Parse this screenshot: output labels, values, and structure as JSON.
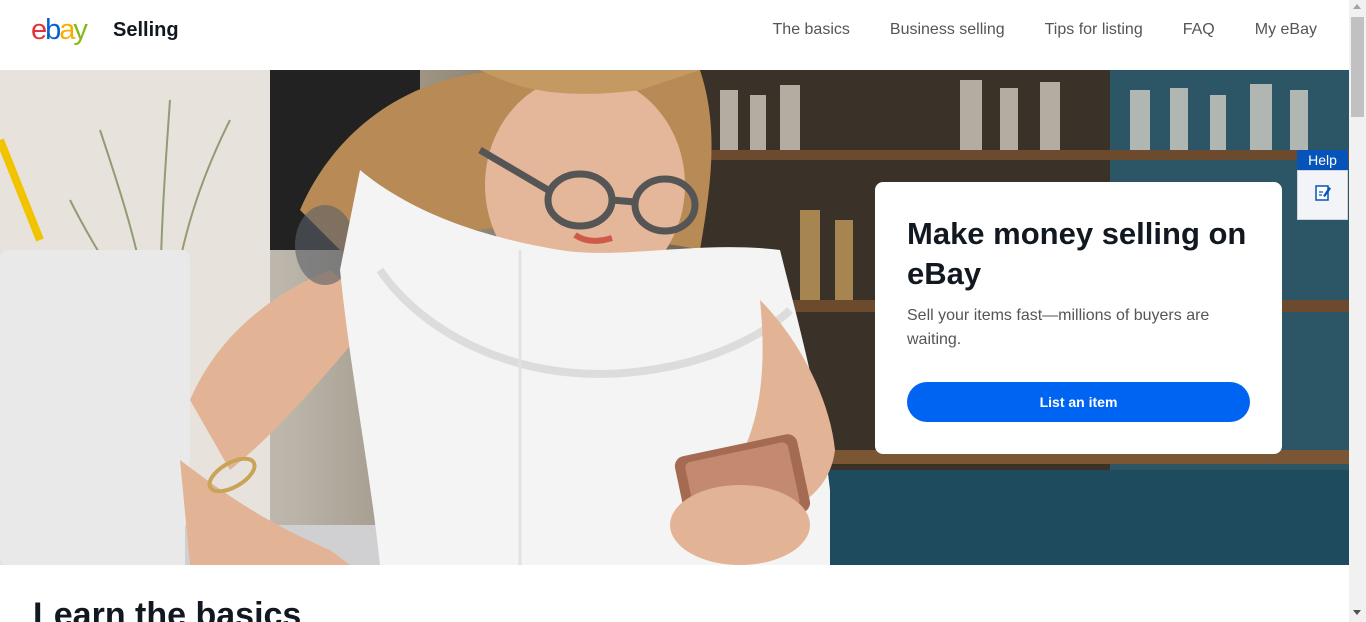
{
  "header": {
    "logo": {
      "letters": [
        "e",
        "b",
        "a",
        "y"
      ],
      "colors": [
        "#e53238",
        "#0064d2",
        "#f5af02",
        "#86b817"
      ],
      "alt": "ebay"
    },
    "title": "Selling",
    "nav": [
      {
        "label": "The basics"
      },
      {
        "label": "Business selling"
      },
      {
        "label": "Tips for listing"
      },
      {
        "label": "FAQ"
      },
      {
        "label": "My eBay"
      }
    ]
  },
  "hero": {
    "heading": "Make money selling on eBay",
    "subtext": "Sell your items fast—millions of buyers are waiting.",
    "cta_label": "List an item",
    "cta_color": "#0064f2"
  },
  "help_widget": {
    "label": "Help",
    "icon": "feedback-icon"
  },
  "section": {
    "title": "Learn the basics"
  }
}
